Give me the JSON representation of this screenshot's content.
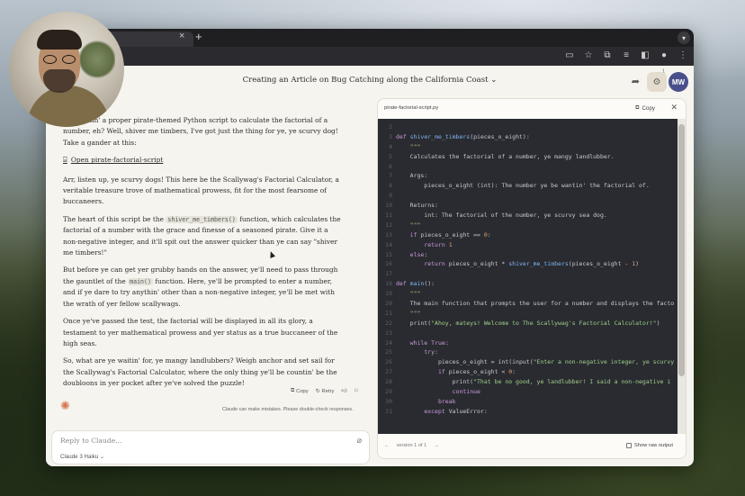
{
  "header": {
    "conversation_title": "Creating an Article on Bug Catching along the California Coast",
    "settings_badge": "1",
    "avatar_initials": "MW"
  },
  "message": {
    "para1": "...e wantin' a proper pirate-themed Python script to calculate the factorial of a number, eh? Well, shiver me timbers, I've got just the thing for ye, ye scurvy dog! Take a gander at this:",
    "artifact_link": "Open pirate-factorial-script",
    "para2": "Arr, listen up, ye scurvy dogs! This here be the Scallywag's Factorial Calculator, a veritable treasure trove of mathematical prowess, fit for the most fearsome of buccaneers.",
    "para3_before": "The heart of this script be the ",
    "para3_code": "shiver_me_timbers()",
    "para3_after": " function, which calculates the factorial of a number with the grace and finesse of a seasoned pirate. Give it a non-negative integer, and it'll spit out the answer quicker than ye can say \"shiver me timbers!\"",
    "para4_before": "But before ye can get yer grubby hands on the answer, ye'll need to pass through the gauntlet of the ",
    "para4_code": "main()",
    "para4_after": " function. Here, ye'll be prompted to enter a number, and if ye dare to try anythin' other than a non-negative integer, ye'll be met with the wrath of yer fellow scallywags.",
    "para5": "Once ye've passed the test, the factorial will be displayed in all its glory, a testament to yer mathematical prowess and yer status as a true buccaneer of the high seas.",
    "para6": "So, what are ye waitin' for, ye mangy landlubbers? Weigh anchor and set sail for the Scallywag's Factorial Calculator, where the only thing ye'll be countin' be the doubloons in yer pocket after ye've solved the puzzle!"
  },
  "actions": {
    "copy": "Copy",
    "retry": "Retry"
  },
  "disclaimer": "Claude can make mistakes. Please double-check responses.",
  "composer": {
    "placeholder": "Reply to Claude...",
    "model": "Claude 3 Haiku"
  },
  "panel": {
    "title": "pirate-factorial-script.py",
    "copy_label": "Copy",
    "version_label": "version 1 of 1",
    "raw_toggle": "Show raw output"
  },
  "code_lines": [
    {
      "n": "2",
      "t": ""
    },
    {
      "n": "3",
      "t": "def shiver_me_timbers(pieces_o_eight):"
    },
    {
      "n": "4",
      "t": "    \"\"\""
    },
    {
      "n": "5",
      "t": "    Calculates the factorial of a number, ye mangy landlubber."
    },
    {
      "n": "6",
      "t": ""
    },
    {
      "n": "7",
      "t": "    Args:"
    },
    {
      "n": "8",
      "t": "        pieces_o_eight (int): The number ye be wantin' the factorial of."
    },
    {
      "n": "9",
      "t": ""
    },
    {
      "n": "10",
      "t": "    Returns:"
    },
    {
      "n": "11",
      "t": "        int: The factorial of the number, ye scurvy sea dog."
    },
    {
      "n": "12",
      "t": "    \"\"\""
    },
    {
      "n": "13",
      "t": "    if pieces_o_eight == 0:"
    },
    {
      "n": "14",
      "t": "        return 1"
    },
    {
      "n": "15",
      "t": "    else:"
    },
    {
      "n": "16",
      "t": "        return pieces_o_eight * shiver_me_timbers(pieces_o_eight - 1)"
    },
    {
      "n": "17",
      "t": ""
    },
    {
      "n": "18",
      "t": "def main():"
    },
    {
      "n": "19",
      "t": "    \"\"\""
    },
    {
      "n": "20",
      "t": "    The main function that prompts the user for a number and displays the facto"
    },
    {
      "n": "21",
      "t": "    \"\"\""
    },
    {
      "n": "22",
      "t": "    print(\"Ahoy, mateys! Welcome to The Scallywag's Factorial Calculator!\")"
    },
    {
      "n": "23",
      "t": ""
    },
    {
      "n": "24",
      "t": "    while True:"
    },
    {
      "n": "25",
      "t": "        try:"
    },
    {
      "n": "26",
      "t": "            pieces_o_eight = int(input(\"Enter a non-negative integer, ye scurvy"
    },
    {
      "n": "27",
      "t": "            if pieces_o_eight < 0:"
    },
    {
      "n": "28",
      "t": "                print(\"That be no good, ye landlubber! I said a non-negative i"
    },
    {
      "n": "29",
      "t": "                continue"
    },
    {
      "n": "30",
      "t": "            break"
    },
    {
      "n": "31",
      "t": "        except ValueError:"
    }
  ]
}
